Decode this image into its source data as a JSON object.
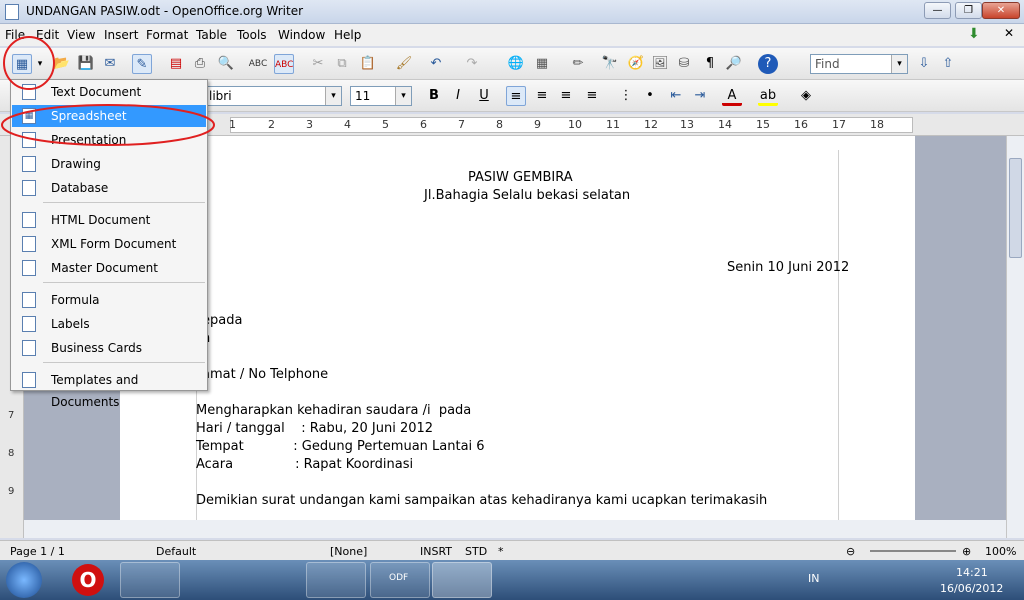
{
  "window": {
    "title": "UNDANGAN PASIW.odt - OpenOffice.org Writer",
    "minimize": "—",
    "maximize": "❐",
    "close": "✕"
  },
  "menubar": [
    "File",
    "Edit",
    "View",
    "Insert",
    "Format",
    "Table",
    "Tools",
    "Window",
    "Help"
  ],
  "toolbar": {
    "find_placeholder": "Find",
    "font_name": "libri",
    "font_size": "11"
  },
  "new_menu": {
    "items": [
      "Text Document",
      "Spreadsheet",
      "Presentation",
      "Drawing",
      "Database",
      "HTML Document",
      "XML Form Document",
      "Master Document",
      "Formula",
      "Labels",
      "Business Cards",
      "Templates and Documents"
    ],
    "selected": "Spreadsheet"
  },
  "ruler": {
    "numbers": [
      "1",
      "2",
      "3",
      "4",
      "5",
      "6",
      "7",
      "8",
      "9",
      "10",
      "11",
      "12",
      "13",
      "14",
      "15",
      "16",
      "17",
      "18"
    ],
    "vertical": [
      "7",
      "8",
      "9"
    ]
  },
  "document": {
    "line1": "PASIW GEMBIRA",
    "line2": "Jl.Bahagia Selalu bekasi selatan",
    "date": "Senin 10 Juni 2012",
    "kepada": "epada",
    "di": "h",
    "alamat": "amat / No Telphone",
    "p1": "Mengharapkan kehadiran saudara /i  pada",
    "p2": "Hari / tanggal    : Rabu, 20 Juni 2012",
    "p3": "Tempat            : Gedung Pertemuan Lantai 6",
    "p4": "Acara               : Rapat Koordinasi",
    "p5": "Demikian surat undangan kami sampaikan atas kehadiranya kami ucapkan terimakasih"
  },
  "statusbar": {
    "page": "Page 1 / 1",
    "style": "Default",
    "lang": "[None]",
    "insert": "INSRT",
    "mode": "STD",
    "modified": "*",
    "zoom": "100%"
  },
  "taskbar": {
    "lang": "IN",
    "time": "14:21",
    "date": "16/06/2012",
    "odf_label": "ODF"
  },
  "colors": {
    "selection": "#3399ff",
    "annotation": "#e02020"
  }
}
